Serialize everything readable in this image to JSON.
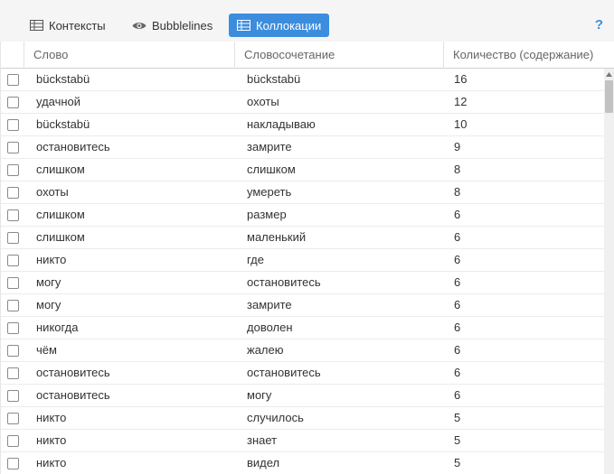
{
  "toolbar": {
    "tabs": [
      {
        "label": "Контексты",
        "icon": "table-icon"
      },
      {
        "label": "Bubblelines",
        "icon": "eye-icon"
      },
      {
        "label": "Коллокации",
        "icon": "table-icon"
      }
    ],
    "active_tab": "Коллокации",
    "help_label": "?"
  },
  "grid": {
    "columns": [
      "Слово",
      "Словосочетание",
      "Количество (содержание)"
    ],
    "rows": [
      {
        "word": "bückstabü",
        "collocate": "bückstabü",
        "count": "16"
      },
      {
        "word": "удачной",
        "collocate": "охоты",
        "count": "12"
      },
      {
        "word": "bückstabü",
        "collocate": "накладываю",
        "count": "10"
      },
      {
        "word": "остановитесь",
        "collocate": "замрите",
        "count": "9"
      },
      {
        "word": "слишком",
        "collocate": "слишком",
        "count": "8"
      },
      {
        "word": "охоты",
        "collocate": "умереть",
        "count": "8"
      },
      {
        "word": "слишком",
        "collocate": "размер",
        "count": "6"
      },
      {
        "word": "слишком",
        "collocate": "маленький",
        "count": "6"
      },
      {
        "word": "никто",
        "collocate": "где",
        "count": "6"
      },
      {
        "word": "могу",
        "collocate": "остановитесь",
        "count": "6"
      },
      {
        "word": "могу",
        "collocate": "замрите",
        "count": "6"
      },
      {
        "word": "никогда",
        "collocate": "доволен",
        "count": "6"
      },
      {
        "word": "чём",
        "collocate": "жалею",
        "count": "6"
      },
      {
        "word": "остановитесь",
        "collocate": "остановитесь",
        "count": "6"
      },
      {
        "word": "остановитесь",
        "collocate": "могу",
        "count": "6"
      },
      {
        "word": "никто",
        "collocate": "случилось",
        "count": "5"
      },
      {
        "word": "никто",
        "collocate": "знает",
        "count": "5"
      },
      {
        "word": "никто",
        "collocate": "видел",
        "count": "5"
      }
    ]
  },
  "colors": {
    "accent": "#3c8dde",
    "toolbar_bg": "#f5f5f5",
    "text": "#333333",
    "header_text": "#666666"
  }
}
